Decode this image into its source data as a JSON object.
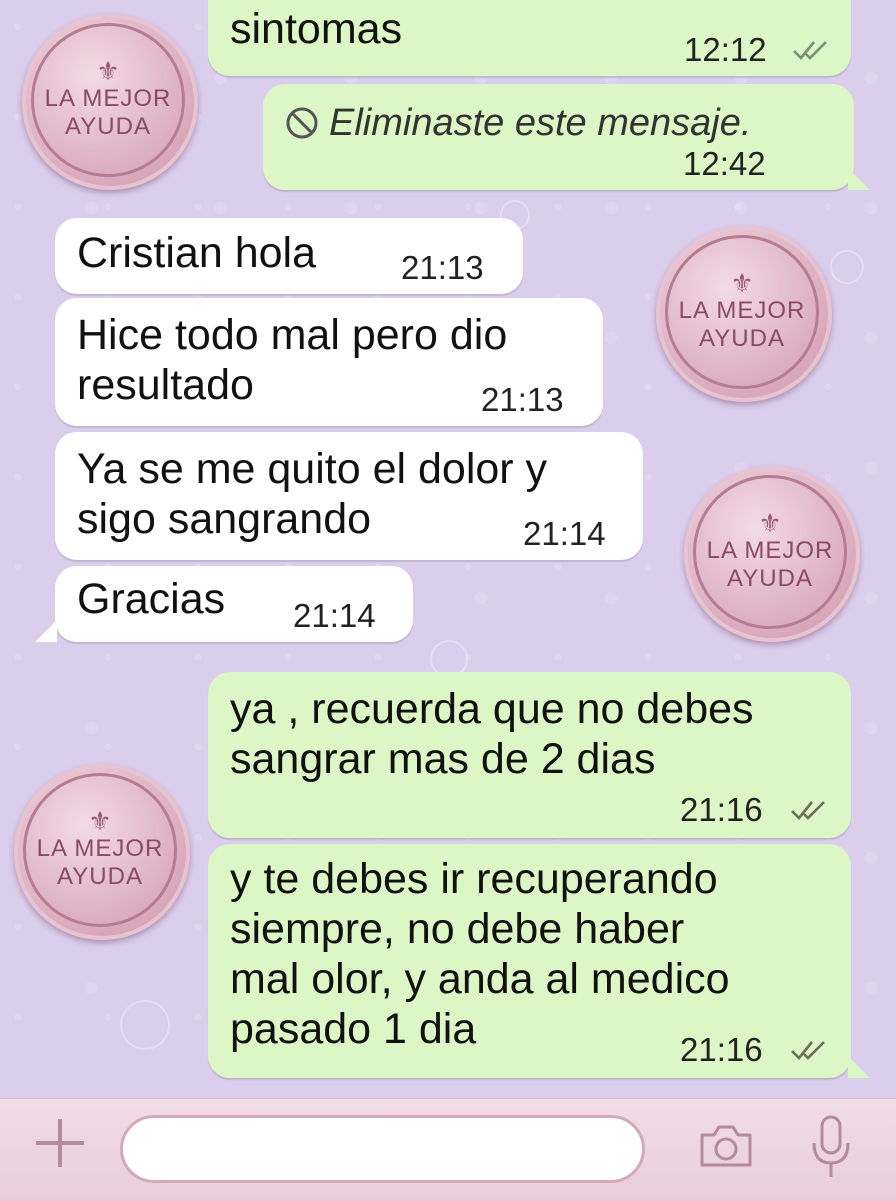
{
  "messages": [
    {
      "dir": "out",
      "text": "sintomas",
      "time": "12:12",
      "ticks": true
    },
    {
      "dir": "out",
      "text": "Eliminaste este mensaje.",
      "time": "12:42",
      "deleted": true
    },
    {
      "dir": "in",
      "text": "Cristian hola",
      "time": "21:13"
    },
    {
      "dir": "in",
      "text": "Hice todo mal pero dio\nresultado",
      "time": "21:13"
    },
    {
      "dir": "in",
      "text": "Ya se me quito el dolor y\nsigo sangrando",
      "time": "21:14"
    },
    {
      "dir": "in",
      "text": "Gracias",
      "time": "21:14"
    },
    {
      "dir": "out",
      "text": "ya , recuerda que no debes\nsangrar mas de 2 dias",
      "time": "21:16",
      "ticks": true
    },
    {
      "dir": "out",
      "text": "y te debes ir recuperando\nsiempre, no debe haber\nmal olor, y anda al medico\npasado 1 dia",
      "time": "21:16",
      "ticks": true
    }
  ],
  "watermark": {
    "line1": "LA MEJOR",
    "line2": "AYUDA"
  },
  "input": {
    "placeholder": ""
  },
  "icons": {
    "attach": "plus-icon",
    "camera": "camera-icon",
    "mic": "microphone-icon",
    "deleted": "blocked-icon",
    "read": "double-check-icon"
  },
  "colors": {
    "outgoing_bubble": "#dcf7c5",
    "incoming_bubble": "#ffffff",
    "background": "#dbcdec",
    "bottom_bar": "#efd9e3"
  }
}
